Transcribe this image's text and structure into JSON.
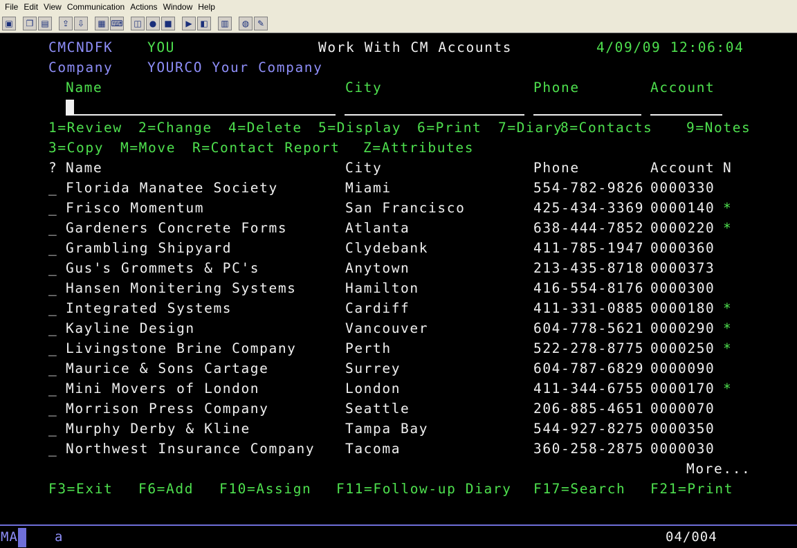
{
  "menubar": [
    "File",
    "Edit",
    "View",
    "Communication",
    "Actions",
    "Window",
    "Help"
  ],
  "header": {
    "program": "CMCNDFK",
    "user": "YOU",
    "title": "Work With CM Accounts",
    "datetime": "4/09/09 12:06:04",
    "company_label": "Company",
    "company_value": "YOURCO Your Company"
  },
  "search": {
    "name_label": "Name",
    "city_label": "City",
    "phone_label": "Phone",
    "account_label": "Account"
  },
  "options_line1": [
    "1=Review",
    "2=Change",
    "4=Delete",
    "5=Display",
    "6=Print",
    "7=Diary",
    "8=Contacts",
    "9=Notes"
  ],
  "options_line2": [
    "3=Copy",
    "M=Move",
    "R=Contact Report",
    "Z=Attributes"
  ],
  "columns": {
    "sel": "?",
    "name": "Name",
    "city": "City",
    "phone": "Phone",
    "account": "Account",
    "notes": "N"
  },
  "rows": [
    {
      "sel": "_",
      "name": "Florida Manatee Society",
      "city": "Miami",
      "phone": "554-782-9826",
      "account": "0000330",
      "note": ""
    },
    {
      "sel": "_",
      "name": "Frisco Momentum",
      "city": "San Francisco",
      "phone": "425-434-3369",
      "account": "0000140",
      "note": "*"
    },
    {
      "sel": "_",
      "name": "Gardeners Concrete Forms",
      "city": "Atlanta",
      "phone": "638-444-7852",
      "account": "0000220",
      "note": "*"
    },
    {
      "sel": "_",
      "name": "Grambling Shipyard",
      "city": "Clydebank",
      "phone": "411-785-1947",
      "account": "0000360",
      "note": ""
    },
    {
      "sel": "_",
      "name": "Gus's Grommets & PC's",
      "city": "Anytown",
      "phone": "213-435-8718",
      "account": "0000373",
      "note": ""
    },
    {
      "sel": "_",
      "name": "Hansen Monitering Systems",
      "city": "Hamilton",
      "phone": "416-554-8176",
      "account": "0000300",
      "note": ""
    },
    {
      "sel": "_",
      "name": "Integrated Systems",
      "city": "Cardiff",
      "phone": "411-331-0885",
      "account": "0000180",
      "note": "*"
    },
    {
      "sel": "_",
      "name": "Kayline Design",
      "city": "Vancouver",
      "phone": "604-778-5621",
      "account": "0000290",
      "note": "*"
    },
    {
      "sel": "_",
      "name": "Livingstone Brine Company",
      "city": "Perth",
      "phone": "522-278-8775",
      "account": "0000250",
      "note": "*"
    },
    {
      "sel": "_",
      "name": "Maurice & Sons Cartage",
      "city": "Surrey",
      "phone": "604-787-6829",
      "account": "0000090",
      "note": ""
    },
    {
      "sel": "_",
      "name": "Mini Movers of London",
      "city": "London",
      "phone": "411-344-6755",
      "account": "0000170",
      "note": "*"
    },
    {
      "sel": "_",
      "name": "Morrison Press Company",
      "city": "Seattle",
      "phone": "206-885-4651",
      "account": "0000070",
      "note": ""
    },
    {
      "sel": "_",
      "name": "Murphy Derby & Kline",
      "city": "Tampa Bay",
      "phone": "544-927-8275",
      "account": "0000350",
      "note": ""
    },
    {
      "sel": "_",
      "name": "Northwest Insurance Company",
      "city": "Tacoma",
      "phone": "360-258-2875",
      "account": "0000030",
      "note": ""
    }
  ],
  "more": "More...",
  "fkeys": [
    "F3=Exit",
    "F6=Add",
    "F10=Assign",
    "F11=Follow-up Diary",
    "F17=Search",
    "F21=Print"
  ],
  "status": {
    "mode": "MA",
    "session": "a",
    "position": "04/004"
  },
  "colors": {
    "field_green": "#4ee04e",
    "label_blue": "#8e8ef8",
    "text_white": "#f0f0f0",
    "background": "#000000"
  }
}
